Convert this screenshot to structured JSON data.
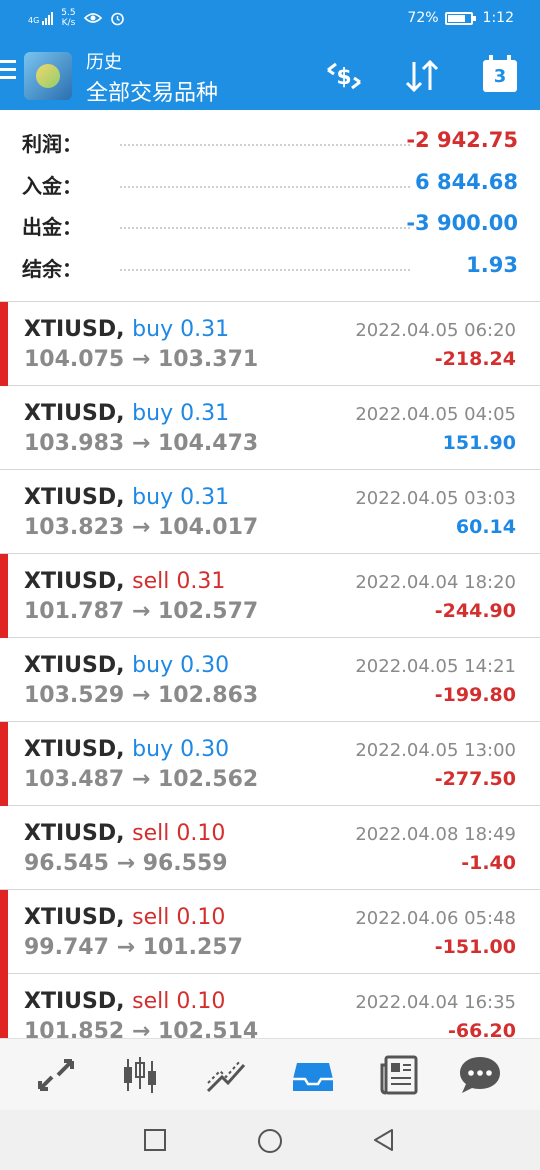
{
  "status_bar": {
    "net_speed": "5.5",
    "net_unit": "K/s",
    "signal_label": "4G",
    "battery": "72%",
    "battery_level": 0.72,
    "time": "1:12"
  },
  "header": {
    "subtitle": "历史",
    "title": "全部交易品种",
    "calendar_day": "3"
  },
  "summary": [
    {
      "label": "利润：",
      "value": "-2 942.75",
      "tone": "neg"
    },
    {
      "label": "入金：",
      "value": "6 844.68",
      "tone": "pos"
    },
    {
      "label": "出金：",
      "value": "-3 900.00",
      "tone": "pos"
    },
    {
      "label": "结余：",
      "value": "1.93",
      "tone": "pos"
    }
  ],
  "trades": [
    {
      "symbol": "XTIUSD,",
      "side": "buy 0.31",
      "side_tone": "pos",
      "open": "104.075",
      "arrow": "→",
      "close": "103.371",
      "time": "2022.04.05 06:20",
      "profit": "-218.24",
      "profit_tone": "neg",
      "marked": true
    },
    {
      "symbol": "XTIUSD,",
      "side": "buy 0.31",
      "side_tone": "pos",
      "open": "103.983",
      "arrow": "→",
      "close": "104.473",
      "time": "2022.04.05 04:05",
      "profit": "151.90",
      "profit_tone": "pos",
      "marked": false
    },
    {
      "symbol": "XTIUSD,",
      "side": "buy 0.31",
      "side_tone": "pos",
      "open": "103.823",
      "arrow": "→",
      "close": "104.017",
      "time": "2022.04.05 03:03",
      "profit": "60.14",
      "profit_tone": "pos",
      "marked": false
    },
    {
      "symbol": "XTIUSD,",
      "side": "sell 0.31",
      "side_tone": "neg",
      "open": "101.787",
      "arrow": "→",
      "close": "102.577",
      "time": "2022.04.04 18:20",
      "profit": "-244.90",
      "profit_tone": "neg",
      "marked": true
    },
    {
      "symbol": "XTIUSD,",
      "side": "buy 0.30",
      "side_tone": "pos",
      "open": "103.529",
      "arrow": "→",
      "close": "102.863",
      "time": "2022.04.05 14:21",
      "profit": "-199.80",
      "profit_tone": "neg",
      "marked": false
    },
    {
      "symbol": "XTIUSD,",
      "side": "buy 0.30",
      "side_tone": "pos",
      "open": "103.487",
      "arrow": "→",
      "close": "102.562",
      "time": "2022.04.05 13:00",
      "profit": "-277.50",
      "profit_tone": "neg",
      "marked": true
    },
    {
      "symbol": "XTIUSD,",
      "side": "sell 0.10",
      "side_tone": "neg",
      "open": "96.545",
      "arrow": "→",
      "close": "96.559",
      "time": "2022.04.08 18:49",
      "profit": "-1.40",
      "profit_tone": "neg",
      "marked": false
    },
    {
      "symbol": "XTIUSD,",
      "side": "sell 0.10",
      "side_tone": "neg",
      "open": "99.747",
      "arrow": "→",
      "close": "101.257",
      "time": "2022.04.06 05:48",
      "profit": "-151.00",
      "profit_tone": "neg",
      "marked": true
    },
    {
      "symbol": "XTIUSD,",
      "side": "sell 0.10",
      "side_tone": "neg",
      "open": "101.852",
      "arrow": "→",
      "close": "102.514",
      "time": "2022.04.04 16:35",
      "profit": "-66.20",
      "profit_tone": "neg",
      "marked": true
    }
  ],
  "bottom_nav": [
    {
      "icon": "quotes-arrows-icon",
      "active": false
    },
    {
      "icon": "candlestick-chart-icon",
      "active": false
    },
    {
      "icon": "trade-chart-icon",
      "active": false
    },
    {
      "icon": "history-inbox-icon",
      "active": true
    },
    {
      "icon": "news-icon",
      "active": false
    },
    {
      "icon": "chat-icon",
      "active": false
    }
  ],
  "colors": {
    "header_bg": "#1e8fe3",
    "positive": "#1e88e5",
    "negative": "#d32f2f",
    "marker": "#e02424",
    "nav_active": "#1e88e5",
    "nav_inactive": "#555555"
  }
}
